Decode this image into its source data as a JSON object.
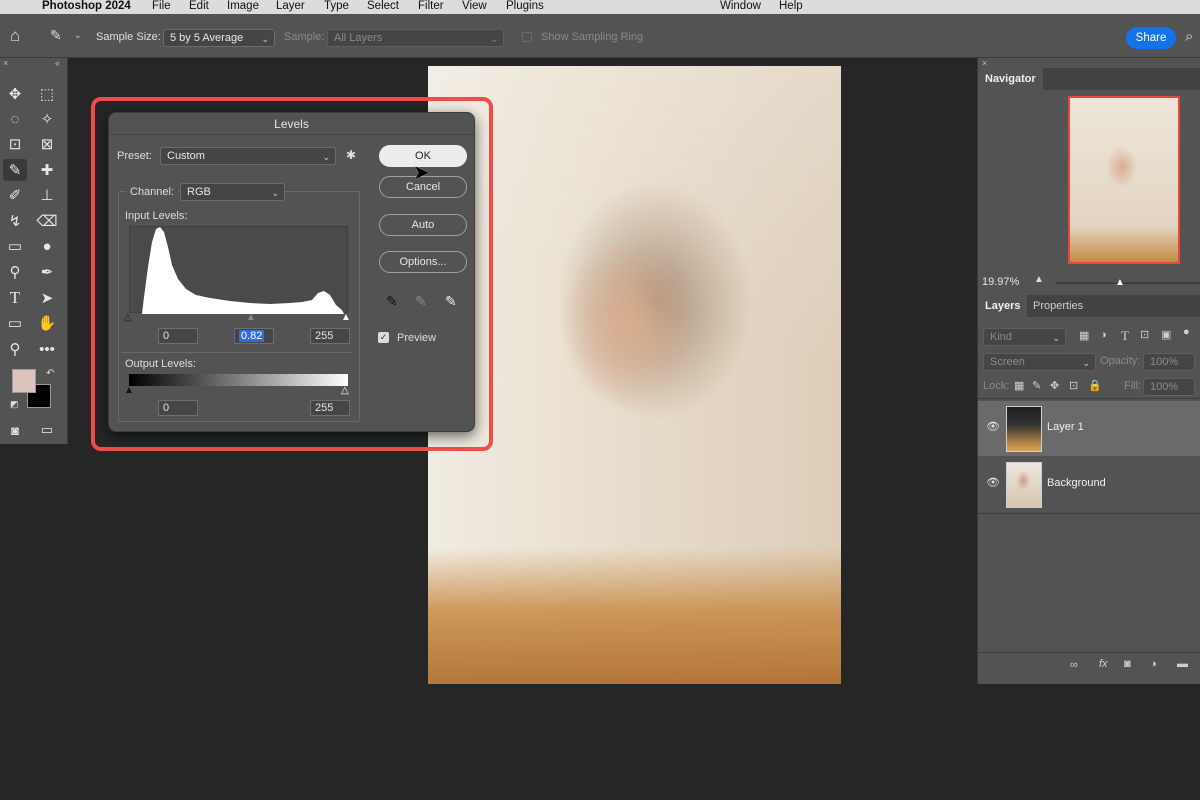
{
  "menubar": {
    "app_name": "Photoshop 2024",
    "items": [
      "File",
      "Edit",
      "Image",
      "Layer",
      "Type",
      "Select",
      "Filter",
      "View",
      "Plugins",
      "Window",
      "Help"
    ]
  },
  "options_bar": {
    "sample_size_label": "Sample Size:",
    "sample_size_value": "5 by 5 Average",
    "sample_label": "Sample:",
    "sample_value": "All Layers",
    "show_sampling_ring": "Show Sampling Ring",
    "share": "Share"
  },
  "levels": {
    "title": "Levels",
    "preset_label": "Preset:",
    "preset_value": "Custom",
    "channel_label": "Channel:",
    "channel_value": "RGB",
    "input_levels_label": "Input Levels:",
    "input_black": "0",
    "input_gamma": "0.82",
    "input_white": "255",
    "output_levels_label": "Output Levels:",
    "output_black": "0",
    "output_white": "255",
    "buttons": {
      "ok": "OK",
      "cancel": "Cancel",
      "auto": "Auto",
      "options": "Options..."
    },
    "preview_label": "Preview",
    "preview_checked": true
  },
  "navigator": {
    "tab": "Navigator",
    "zoom": "19.97%"
  },
  "layers_panel": {
    "tabs": [
      "Layers",
      "Properties"
    ],
    "filter_kind": "Kind",
    "blend_mode": "Screen",
    "opacity_label": "Opacity:",
    "opacity_value": "100%",
    "lock_label": "Lock:",
    "fill_label": "Fill:",
    "fill_value": "100%",
    "layers": [
      {
        "name": "Layer 1",
        "selected": true
      },
      {
        "name": "Background",
        "selected": false
      }
    ]
  },
  "colors": {
    "foreground": "#dcc3bd",
    "background": "#000000",
    "highlight": "#ee4e45",
    "accent": "#1473e6"
  }
}
